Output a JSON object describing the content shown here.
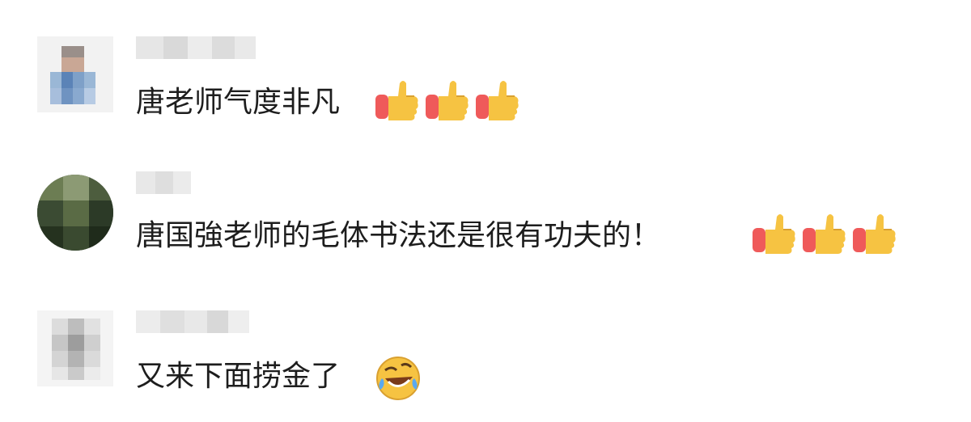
{
  "comments": [
    {
      "text": "唐老师气度非凡",
      "reactions": [
        "thumbs-up",
        "thumbs-up",
        "thumbs-up"
      ]
    },
    {
      "text": "唐国強老师的毛体书法还是很有功夫的！",
      "reactions": [
        "thumbs-up",
        "thumbs-up",
        "thumbs-up"
      ]
    },
    {
      "text": "又来下面捞金了",
      "reactions": [
        "rolling-on-floor-laughing"
      ]
    }
  ],
  "colors": {
    "text": "#1d1d1d",
    "background": "#ffffff",
    "blur_light": "#e3e3e3",
    "blur_mid": "#cfcfcf",
    "thumb_yellow": "#f6c342",
    "cuff_red": "#ef5a5a"
  }
}
